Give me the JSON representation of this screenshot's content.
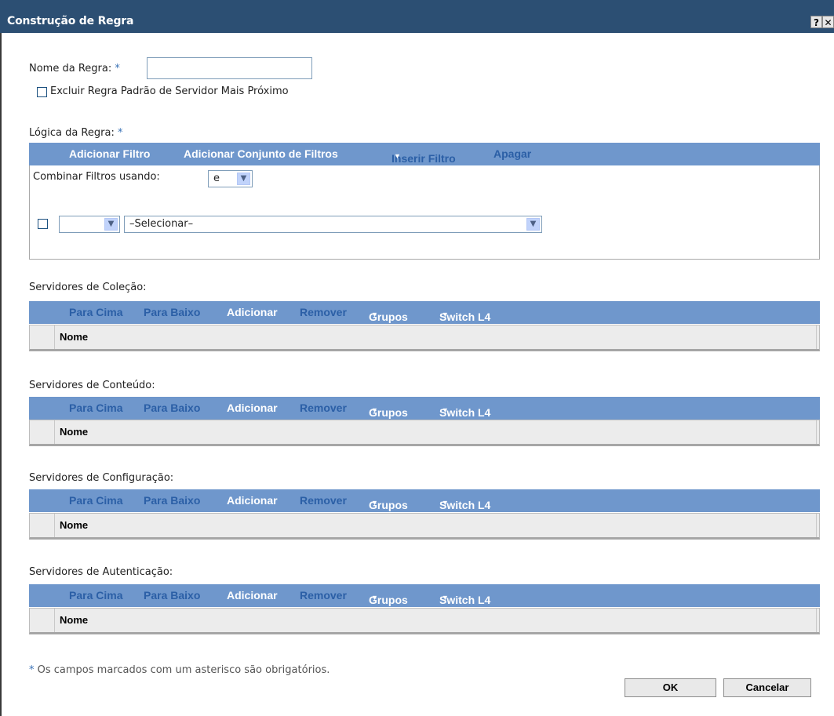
{
  "window": {
    "title": "Construção de Regra",
    "help_label": "?",
    "close_label": "✕"
  },
  "form": {
    "rule_name_label": "Nome da Regra:",
    "required_mark": "*",
    "rule_name_value": "",
    "exclude_label": "Excluir Regra Padrão de Servidor Mais Próximo",
    "logic_label": "Lógica da Regra:"
  },
  "filter_panel": {
    "toolbar": {
      "add_filter": "Adicionar Filtro",
      "add_filter_set": "Adicionar Conjunto de Filtros",
      "insert_filter": "Inserir Filtro",
      "delete": "Apagar"
    },
    "combine_label": "Combinar Filtros usando:",
    "combine_value": "e",
    "row": {
      "operator_value": "",
      "criteria_value": "–Selecionar–"
    }
  },
  "server_toolbar": {
    "up": "Para Cima",
    "down": "Para Baixo",
    "add": "Adicionar",
    "remove": "Remover",
    "groups": "Grupos",
    "switch": "Switch L4"
  },
  "server_sections": [
    {
      "title": "Servidores de Coleção:",
      "column": "Nome"
    },
    {
      "title": "Servidores de Conteúdo:",
      "column": "Nome"
    },
    {
      "title": "Servidores de Configuração:",
      "column": "Nome"
    },
    {
      "title": "Servidores de Autenticação:",
      "column": "Nome"
    }
  ],
  "footer": {
    "note": "Os campos marcados com um asterisco são obrigatórios.",
    "ok": "OK",
    "cancel": "Cancelar"
  },
  "colors": {
    "titlebar": "#2c4f73",
    "toolbar": "#6f97cc",
    "toolbar_active_text": "#ffffff",
    "toolbar_disabled_text": "#2b5fa6",
    "required": "#3a72b6"
  }
}
